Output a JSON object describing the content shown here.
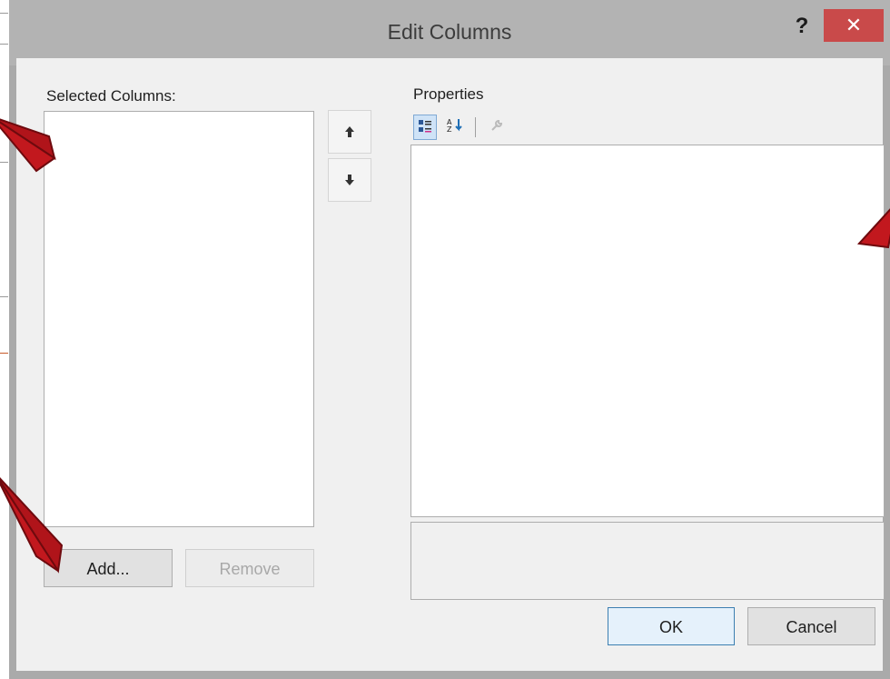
{
  "dialog": {
    "title": "Edit Columns",
    "help_label": "?",
    "close_label": "✕"
  },
  "left": {
    "label": "Selected Columns:",
    "items": [],
    "move_up_label": "🡅",
    "move_down_label": "🡇",
    "add_label": "Add...",
    "remove_label": "Remove"
  },
  "right": {
    "label": "Properties",
    "toolbar": {
      "categorized_icon": "categorized-icon",
      "alphabetical_icon": "alphabetical-icon",
      "property_pages_icon": "wrench-icon"
    }
  },
  "footer": {
    "ok_label": "OK",
    "cancel_label": "Cancel"
  },
  "colors": {
    "titlebar": "#b3b3b3",
    "close_button": "#c94a4a",
    "client": "#f0f0f0",
    "annotation_arrow": "#b0141a"
  }
}
